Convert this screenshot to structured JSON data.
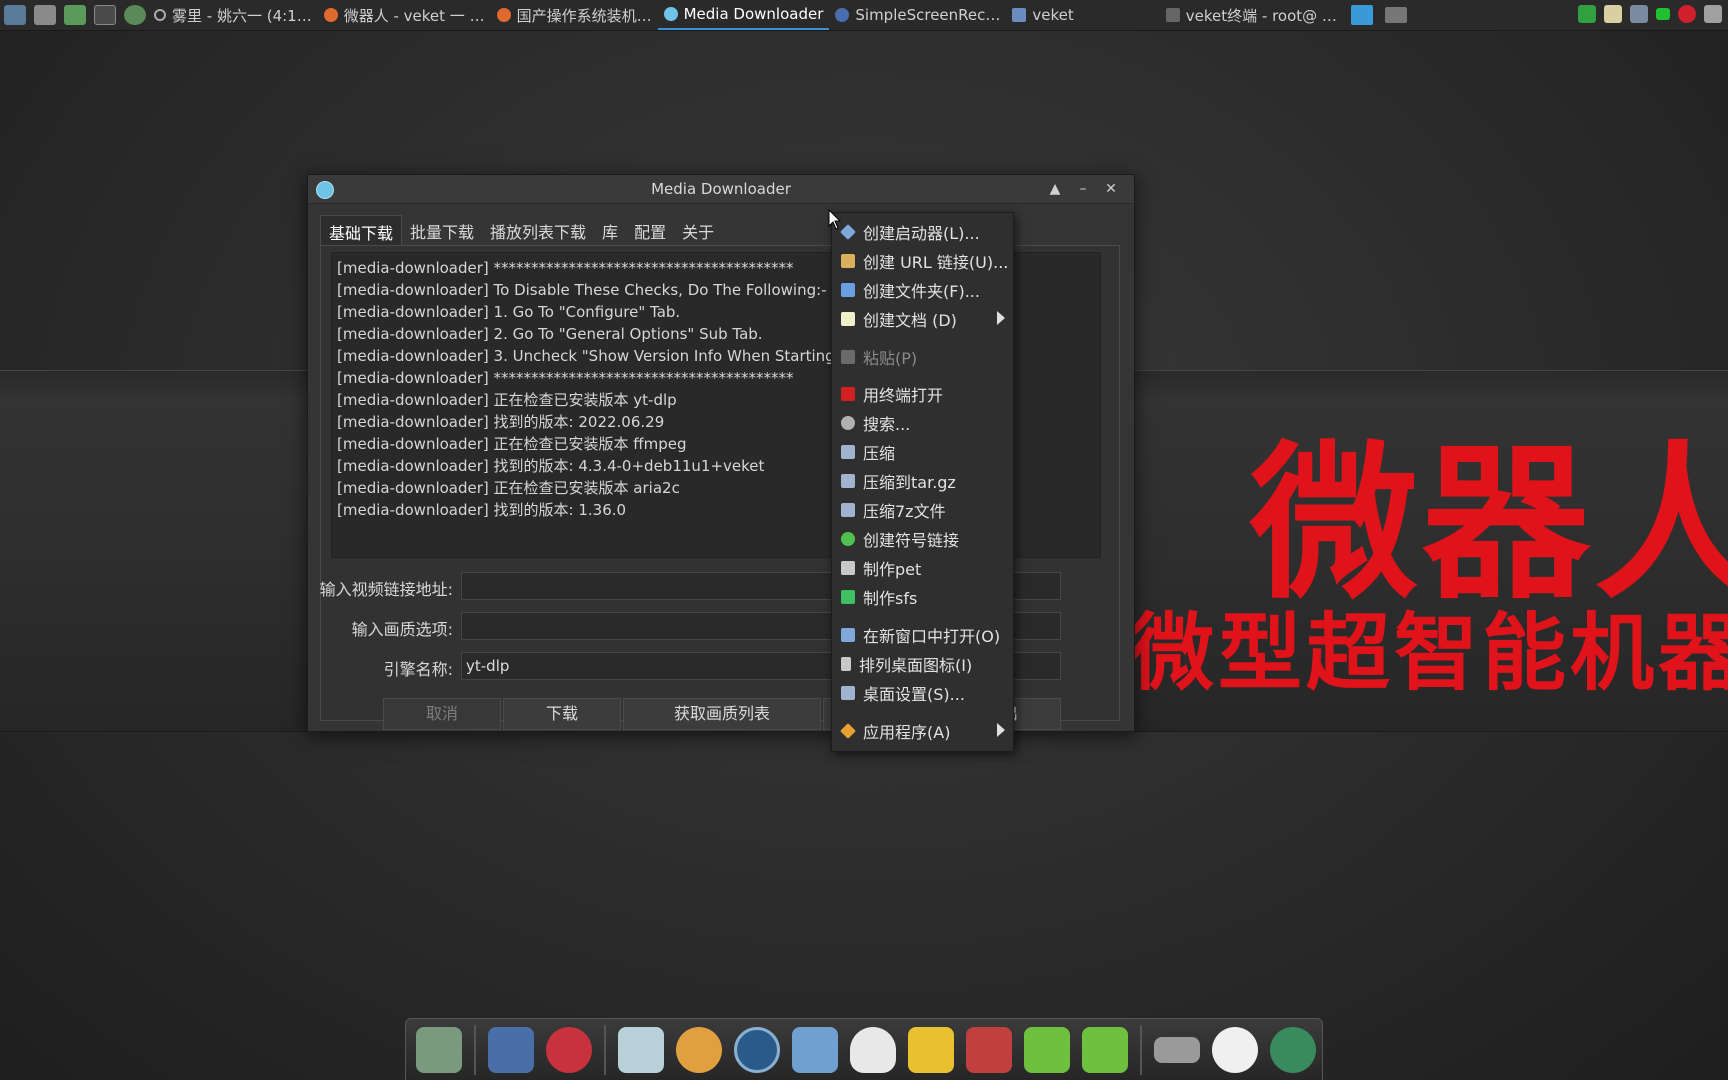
{
  "taskbar": {
    "tasks": [
      {
        "label": "雾里 - 姚六一 (4:1…",
        "icon_color": "#d0d0d0"
      },
      {
        "label": "微器人 - veket 一 …",
        "icon_color": "#e0692d"
      },
      {
        "label": "国产操作系统装机…",
        "icon_color": "#e0692d"
      },
      {
        "label": "Media Downloader",
        "icon_color": "#6ec3e6"
      },
      {
        "label": "SimpleScreenRec…",
        "icon_color": "#4a6fb0"
      },
      {
        "label": "veket",
        "icon_color": "#6a8cc0"
      },
      {
        "label": "veket终端 - root@ …",
        "icon_color": "#9a9a9a"
      }
    ]
  },
  "window": {
    "title": "Media Downloader",
    "tabs": [
      "基础下载",
      "批量下载",
      "播放列表下载",
      "库",
      "配置",
      "关于"
    ],
    "log_lines": [
      "[media-downloader] ****************************************",
      "[media-downloader] To Disable These Checks, Do The Following:-",
      "[media-downloader] 1. Go To \"Configure\" Tab.",
      "[media-downloader] 2. Go To \"General Options\" Sub Tab.",
      "[media-downloader] 3. Uncheck \"Show Version Info When Starting\".",
      "[media-downloader] ****************************************",
      "[media-downloader] 正在检查已安装版本 yt-dlp",
      "[media-downloader] 找到的版本: 2022.06.29",
      "[media-downloader] 正在检查已安装版本 ffmpeg",
      "[media-downloader] 找到的版本: 4.3.4-0+deb11u1+veket",
      "[media-downloader] 正在检查已安装版本 aria2c",
      "[media-downloader] 找到的版本: 1.36.0"
    ],
    "url_label": "输入视频链接地址:",
    "url_value": "",
    "quality_label": "输入画质选项:",
    "quality_value": "",
    "engine_label": "引擎名称:",
    "engine_value": "yt-dlp",
    "buttons": {
      "cancel": "取消",
      "download": "下载",
      "get_quality": "获取画质列表",
      "hidden_partial": "出"
    }
  },
  "context_menu": {
    "items": [
      {
        "label": "创建启动器(L)...",
        "icon_color": "#7fa8d8"
      },
      {
        "label": "创建 URL 链接(U)...",
        "icon_color": "#d8b060"
      },
      {
        "label": "创建文件夹(F)...",
        "icon_color": "#6aa0e0"
      },
      {
        "label": "创建文档 (D)",
        "icon_color": "#f0f0c8",
        "submenu": true
      },
      {
        "label": "粘贴(P)",
        "icon_color": "#6a6a6a",
        "disabled": true
      },
      {
        "label": "用终端打开",
        "icon_color": "#d02020"
      },
      {
        "label": "搜索...",
        "icon_color": "#b0b0b0"
      },
      {
        "label": "压缩",
        "icon_color": "#a0b4d0"
      },
      {
        "label": "压缩到tar.gz",
        "icon_color": "#a0b4d0"
      },
      {
        "label": "压缩7z文件",
        "icon_color": "#a0b4d0"
      },
      {
        "label": "创建符号链接",
        "icon_color": "#50c050"
      },
      {
        "label": "制作pet",
        "icon_color": "#c8c8c8"
      },
      {
        "label": "制作sfs",
        "icon_color": "#40c060"
      },
      {
        "label": "在新窗口中打开(O)",
        "icon_color": "#7fa8d8"
      },
      {
        "label": "排列桌面图标(I)",
        "icon_color": "#c8c8c8"
      },
      {
        "label": "桌面设置(S)...",
        "icon_color": "#a0b4d0"
      },
      {
        "label": "应用程序(A)",
        "icon_color": "#e8a030",
        "submenu": true
      }
    ]
  },
  "wallpaper": {
    "big": "微器人",
    "small": "微型超智能机器",
    "color": "#e0121a"
  },
  "dock": {
    "icons": [
      {
        "name": "graph-icon",
        "color": "#7a9a80"
      },
      {
        "name": "monitor-icon",
        "color": "#4a6fa8"
      },
      {
        "name": "hedgehog-icon",
        "color": "#c8323c"
      },
      {
        "name": "notepad-icon",
        "color": "#b8d0d8"
      },
      {
        "name": "palette-icon",
        "color": "#e0a040"
      },
      {
        "name": "disc-icon",
        "color": "#2a5a8a"
      },
      {
        "name": "network-users-icon",
        "color": "#70a0d0"
      },
      {
        "name": "penguin-icon",
        "color": "#e8e8e8"
      },
      {
        "name": "book-icon",
        "color": "#e8c030"
      },
      {
        "name": "chart-icon",
        "color": "#c04040"
      },
      {
        "name": "help-icon",
        "color": "#70c040"
      },
      {
        "name": "help-icon-2",
        "color": "#70c040"
      },
      {
        "name": "drive-icon",
        "color": "#9a9a9a"
      },
      {
        "name": "brightness-icon",
        "color": "#f0f0f0"
      },
      {
        "name": "globe-icon",
        "color": "#3a8a60"
      }
    ]
  }
}
